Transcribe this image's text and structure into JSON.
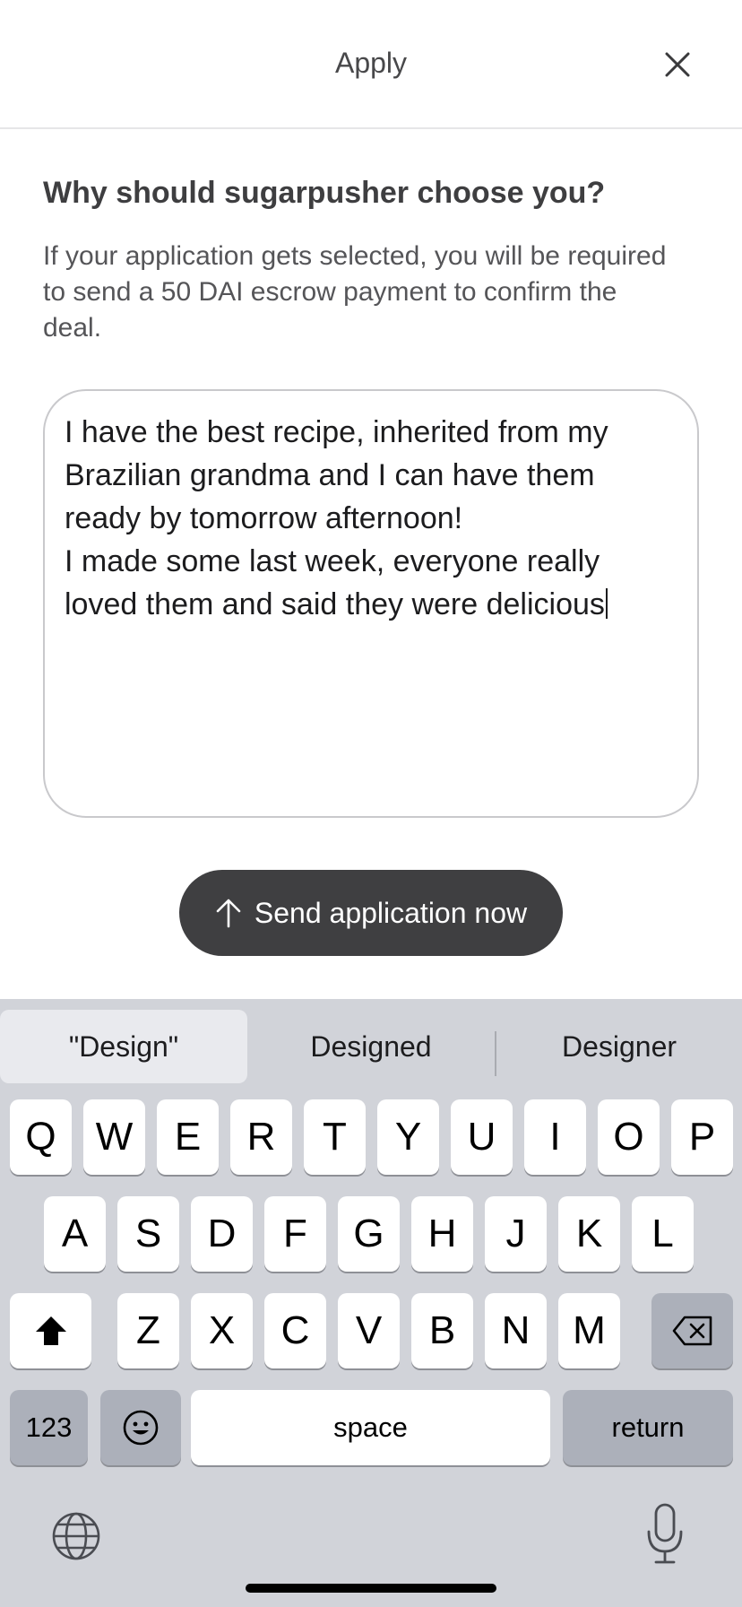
{
  "header": {
    "title": "Apply",
    "close_icon": "close-icon"
  },
  "form": {
    "heading": "Why should sugarpusher choose you?",
    "description": "If your application gets selected, you will be required to send a 50 DAI escrow payment to confirm the deal.",
    "message_value": "I have the best recipe, inherited from my Brazilian grandma and I can have them ready by tomorrow afternoon!\nI made some last week, everyone really loved them and said they were delicious"
  },
  "send_button": {
    "label": "Send application now",
    "icon": "arrow-up-icon"
  },
  "keyboard": {
    "suggestions": [
      "\"Design\"",
      "Designed",
      "Designer"
    ],
    "row1": [
      "Q",
      "W",
      "E",
      "R",
      "T",
      "Y",
      "U",
      "I",
      "O",
      "P"
    ],
    "row2": [
      "A",
      "S",
      "D",
      "F",
      "G",
      "H",
      "J",
      "K",
      "L"
    ],
    "row3": [
      "Z",
      "X",
      "C",
      "V",
      "B",
      "N",
      "M"
    ],
    "numbers_label": "123",
    "space_label": "space",
    "return_label": "return",
    "icons": [
      "shift-icon",
      "backspace-icon",
      "emoji-icon",
      "globe-icon",
      "microphone-icon"
    ]
  }
}
